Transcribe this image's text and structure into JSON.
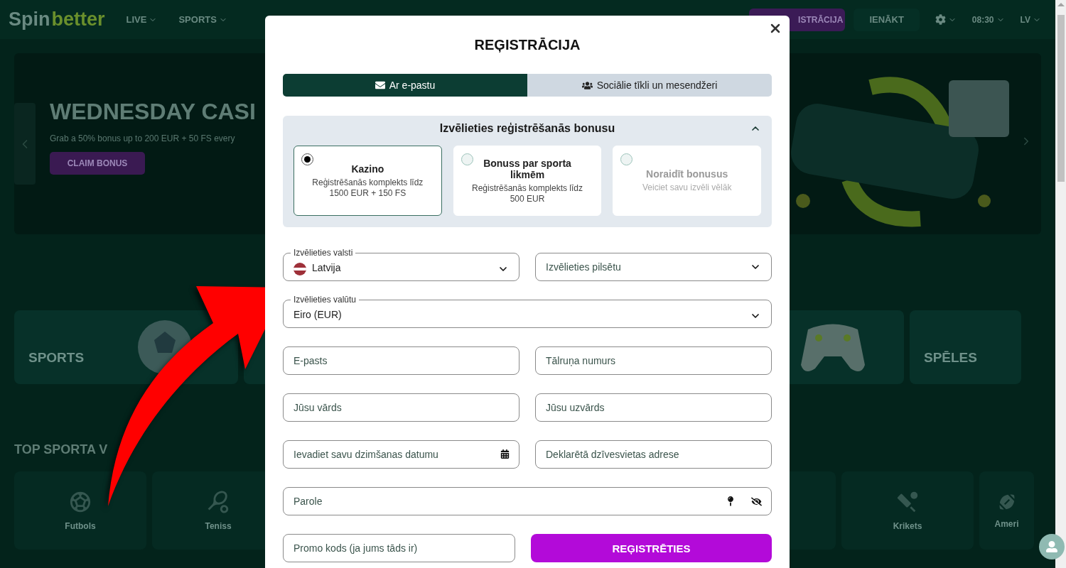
{
  "header": {
    "logo": {
      "first": "Spin",
      "second": "better"
    },
    "nav": [
      {
        "label": "LIVE"
      },
      {
        "label": "SPORTS"
      }
    ],
    "register_button": "ISTRĀCIJA",
    "login_button": "IENĀKT",
    "time": "08:30",
    "language": "LV"
  },
  "banner": {
    "title": "WEDNESDAY CASI",
    "subtitle": "Grab a 50% bonus up to 200 EUR + 50 FS every",
    "button": "CLAIM BONUS"
  },
  "categories": [
    {
      "label": "SPORTS"
    },
    {
      "label": "SPĒLES"
    }
  ],
  "section_title": "TOP SPORTA V",
  "sport_tiles": [
    {
      "label": "Futbols"
    },
    {
      "label": "Teniss"
    },
    {
      "label": "Krikets"
    },
    {
      "label": "Ameri"
    }
  ],
  "modal": {
    "title": "REĢISTRĀCIJA",
    "tabs": [
      {
        "label": "Ar e-pastu",
        "selected": true
      },
      {
        "label": "Sociālie tīkli un mesendžeri",
        "selected": false
      }
    ],
    "bonus": {
      "title": "Izvēlieties reģistrēšanās bonusu",
      "expanded": true,
      "options": [
        {
          "title": "Kazino",
          "description": "Reģistrēšanās komplekts līdz 1500 EUR + 150 FS",
          "selected": true,
          "disabled": false
        },
        {
          "title": "Bonuss par sporta likmēm",
          "description": "Reģistrēšanās komplekts līdz 500 EUR",
          "selected": false,
          "disabled": false
        },
        {
          "title": "Noraidīt bonusus",
          "description": "Veiciet savu izvēli vēlāk",
          "selected": false,
          "disabled": true
        }
      ]
    },
    "form": {
      "rows": [
        [
          {
            "kind": "select",
            "label": "Izvēlieties valsti",
            "value": "Latvija",
            "flag": true
          },
          {
            "kind": "select",
            "placeholder": "Izvēlieties pilsētu"
          }
        ],
        [
          {
            "kind": "select",
            "label": "Izvēlieties valūtu",
            "value": "Eiro (EUR)"
          }
        ],
        [
          {
            "kind": "input",
            "placeholder": "E-pasts"
          },
          {
            "kind": "input",
            "placeholder": "Tālruņa numurs"
          }
        ],
        [
          {
            "kind": "input",
            "placeholder": "Jūsu vārds"
          },
          {
            "kind": "input",
            "placeholder": "Jūsu uzvārds"
          }
        ],
        [
          {
            "kind": "date",
            "placeholder": "Ievadiet savu dzimšanas datumu"
          },
          {
            "kind": "input",
            "placeholder": "Deklarētā dzīvesvietas adrese"
          }
        ],
        [
          {
            "kind": "password",
            "placeholder": "Parole"
          }
        ],
        [
          {
            "kind": "input",
            "placeholder": "Promo kods (ja jums tāds ir)"
          },
          {
            "kind": "submit",
            "label": "REĢISTRĒTIES"
          }
        ]
      ]
    }
  }
}
